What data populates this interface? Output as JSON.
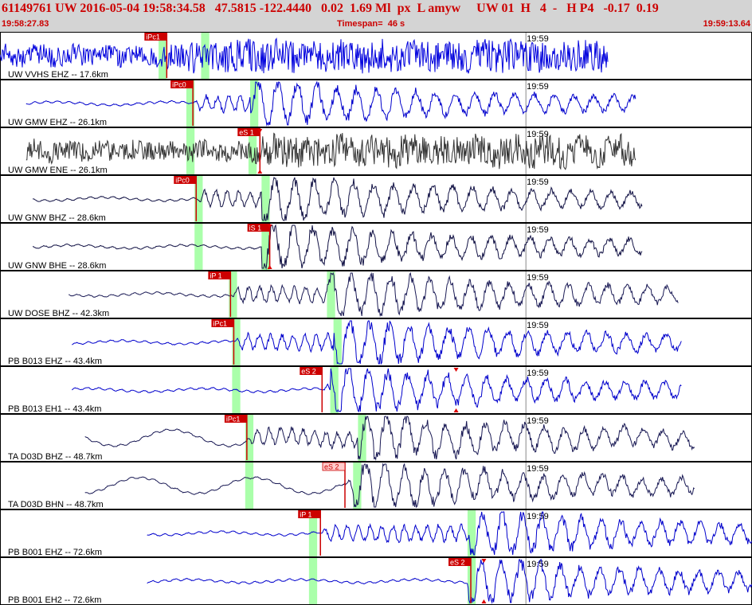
{
  "header": {
    "event_id": "61149761",
    "network": "UW",
    "date": "2016-05-04",
    "origin_time": "19:58:34.58",
    "lat": "47.5815",
    "lon": "-122.4440",
    "depth": "0.02",
    "magnitude": "1.69",
    "mag_type": "Ml",
    "flag1": "px",
    "flag2": "L",
    "author": "amyw",
    "net2": "UW",
    "version": "01",
    "flag3": "H",
    "count": "4",
    "dash": "-",
    "flag4": "H",
    "flag5": "P4",
    "v1": "-0.17",
    "v2": "0.19"
  },
  "window": {
    "start": "19:58:27.83",
    "timespan_label": "Timespan=",
    "timespan_value": "46 s",
    "end": "19:59:13.64"
  },
  "colors": {
    "header_bg": "#d4d4d4",
    "header_text": "#cc0000",
    "trace_blue": "#0000cc",
    "trace_navy": "#1a1a55",
    "trace_gray": "#333333",
    "pick_label_bg": "#cc0000",
    "pick_label_bg_light": "#ffcccc",
    "window_green": "#aaffaa"
  },
  "chart_data": {
    "type": "line",
    "title": "",
    "x_unit": "s",
    "x_range": [
      0,
      46
    ],
    "minute_mark_label": "19:59",
    "minute_mark_seconds": 32.17,
    "panels": [
      {
        "station": "UW VVHS EHZ -- 17.6km",
        "trace_color": "#0000dd",
        "data_start_s": 0.0,
        "data_end_s": 37.2,
        "style": "noise",
        "picks": [
          {
            "label": "iPc1",
            "time_s": 10.2,
            "light": false
          }
        ],
        "windows_s": [
          [
            9.7,
            10.2
          ],
          [
            12.3,
            12.8
          ]
        ],
        "markers": []
      },
      {
        "station": "UW GMW EHZ -- 26.1km",
        "trace_color": "#0000cc",
        "data_start_s": 1.6,
        "data_end_s": 38.9,
        "style": "quake",
        "picks": [
          {
            "label": "iPc0",
            "time_s": 11.8,
            "light": false
          }
        ],
        "windows_s": [
          [
            11.4,
            11.9
          ],
          [
            15.3,
            15.8
          ]
        ],
        "markers": []
      },
      {
        "station": "UW GMW ENE -- 26.1km",
        "trace_color": "#333333",
        "data_start_s": 1.6,
        "data_end_s": 38.9,
        "style": "noise",
        "picks": [
          {
            "label": "eS 1",
            "time_s": 15.9,
            "light": false
          }
        ],
        "windows_s": [
          [
            11.4,
            11.9
          ],
          [
            15.2,
            15.7
          ]
        ],
        "markers": [
          15.9
        ]
      },
      {
        "station": "UW GNW BHZ -- 28.6km",
        "trace_color": "#111144",
        "data_start_s": 2.0,
        "data_end_s": 39.3,
        "style": "quake",
        "picks": [
          {
            "label": "iPc0",
            "time_s": 12.0,
            "light": false
          }
        ],
        "windows_s": [
          [
            11.9,
            12.4
          ],
          [
            16.0,
            16.5
          ]
        ],
        "markers": []
      },
      {
        "station": "UW GNW BHE -- 28.6km",
        "trace_color": "#111144",
        "data_start_s": 2.0,
        "data_end_s": 39.3,
        "style": "quake",
        "picks": [
          {
            "label": "iS 1",
            "time_s": 16.5,
            "light": false
          }
        ],
        "windows_s": [
          [
            11.9,
            12.4
          ],
          [
            16.0,
            16.5
          ]
        ],
        "markers": [
          16.5
        ]
      },
      {
        "station": "UW DOSE BHZ -- 42.3km",
        "trace_color": "#1a1a55",
        "data_start_s": 4.2,
        "data_end_s": 41.5,
        "style": "quake",
        "picks": [
          {
            "label": "iP 1",
            "time_s": 14.1,
            "light": false
          }
        ],
        "windows_s": [
          [
            14.0,
            14.5
          ],
          [
            20.0,
            20.5
          ]
        ],
        "markers": []
      },
      {
        "station": "PB B013 EHZ -- 43.4km",
        "trace_color": "#0000cc",
        "data_start_s": 4.4,
        "data_end_s": 41.7,
        "style": "quake",
        "picks": [
          {
            "label": "iPc1",
            "time_s": 14.3,
            "light": false
          }
        ],
        "windows_s": [
          [
            14.2,
            14.7
          ],
          [
            20.4,
            20.9
          ]
        ],
        "markers": []
      },
      {
        "station": "PB B013 EH1 -- 43.4km",
        "trace_color": "#0000cc",
        "data_start_s": 4.4,
        "data_end_s": 41.7,
        "style": "quake",
        "picks": [
          {
            "label": "eS 2",
            "time_s": 19.7,
            "light": false
          }
        ],
        "windows_s": [
          [
            14.2,
            14.7
          ],
          [
            20.2,
            20.7
          ]
        ],
        "markers": [
          27.9
        ]
      },
      {
        "station": "TA D03D BHZ -- 48.7km",
        "trace_color": "#1a1a55",
        "data_start_s": 5.2,
        "data_end_s": 42.5,
        "style": "quake",
        "picks": [
          {
            "label": "iPc1",
            "time_s": 15.1,
            "light": false
          }
        ],
        "windows_s": [
          [
            15.0,
            15.5
          ],
          [
            21.9,
            22.4
          ]
        ],
        "markers": []
      },
      {
        "station": "TA D03D BHN -- 48.7km",
        "trace_color": "#1a1a55",
        "data_start_s": 5.2,
        "data_end_s": 42.5,
        "style": "quake",
        "picks": [
          {
            "label": "eS 2",
            "time_s": 21.1,
            "light": true
          }
        ],
        "windows_s": [
          [
            15.0,
            15.5
          ],
          [
            21.6,
            22.1
          ]
        ],
        "markers": []
      },
      {
        "station": "PB B001 EHZ -- 72.6km",
        "trace_color": "#0000cc",
        "data_start_s": 9.0,
        "data_end_s": 46.0,
        "style": "quake",
        "picks": [
          {
            "label": "iP 1",
            "time_s": 19.6,
            "light": false
          }
        ],
        "windows_s": [
          [
            18.9,
            19.4
          ],
          [
            28.6,
            29.1
          ]
        ],
        "markers": []
      },
      {
        "station": "PB B001 EH2 -- 72.6km",
        "trace_color": "#0000cc",
        "data_start_s": 9.0,
        "data_end_s": 46.0,
        "style": "quake",
        "picks": [
          {
            "label": "eS 2",
            "time_s": 28.8,
            "light": false
          }
        ],
        "windows_s": [
          [
            18.9,
            19.4
          ],
          [
            28.6,
            29.1
          ]
        ],
        "markers": [
          29.6
        ]
      }
    ]
  }
}
